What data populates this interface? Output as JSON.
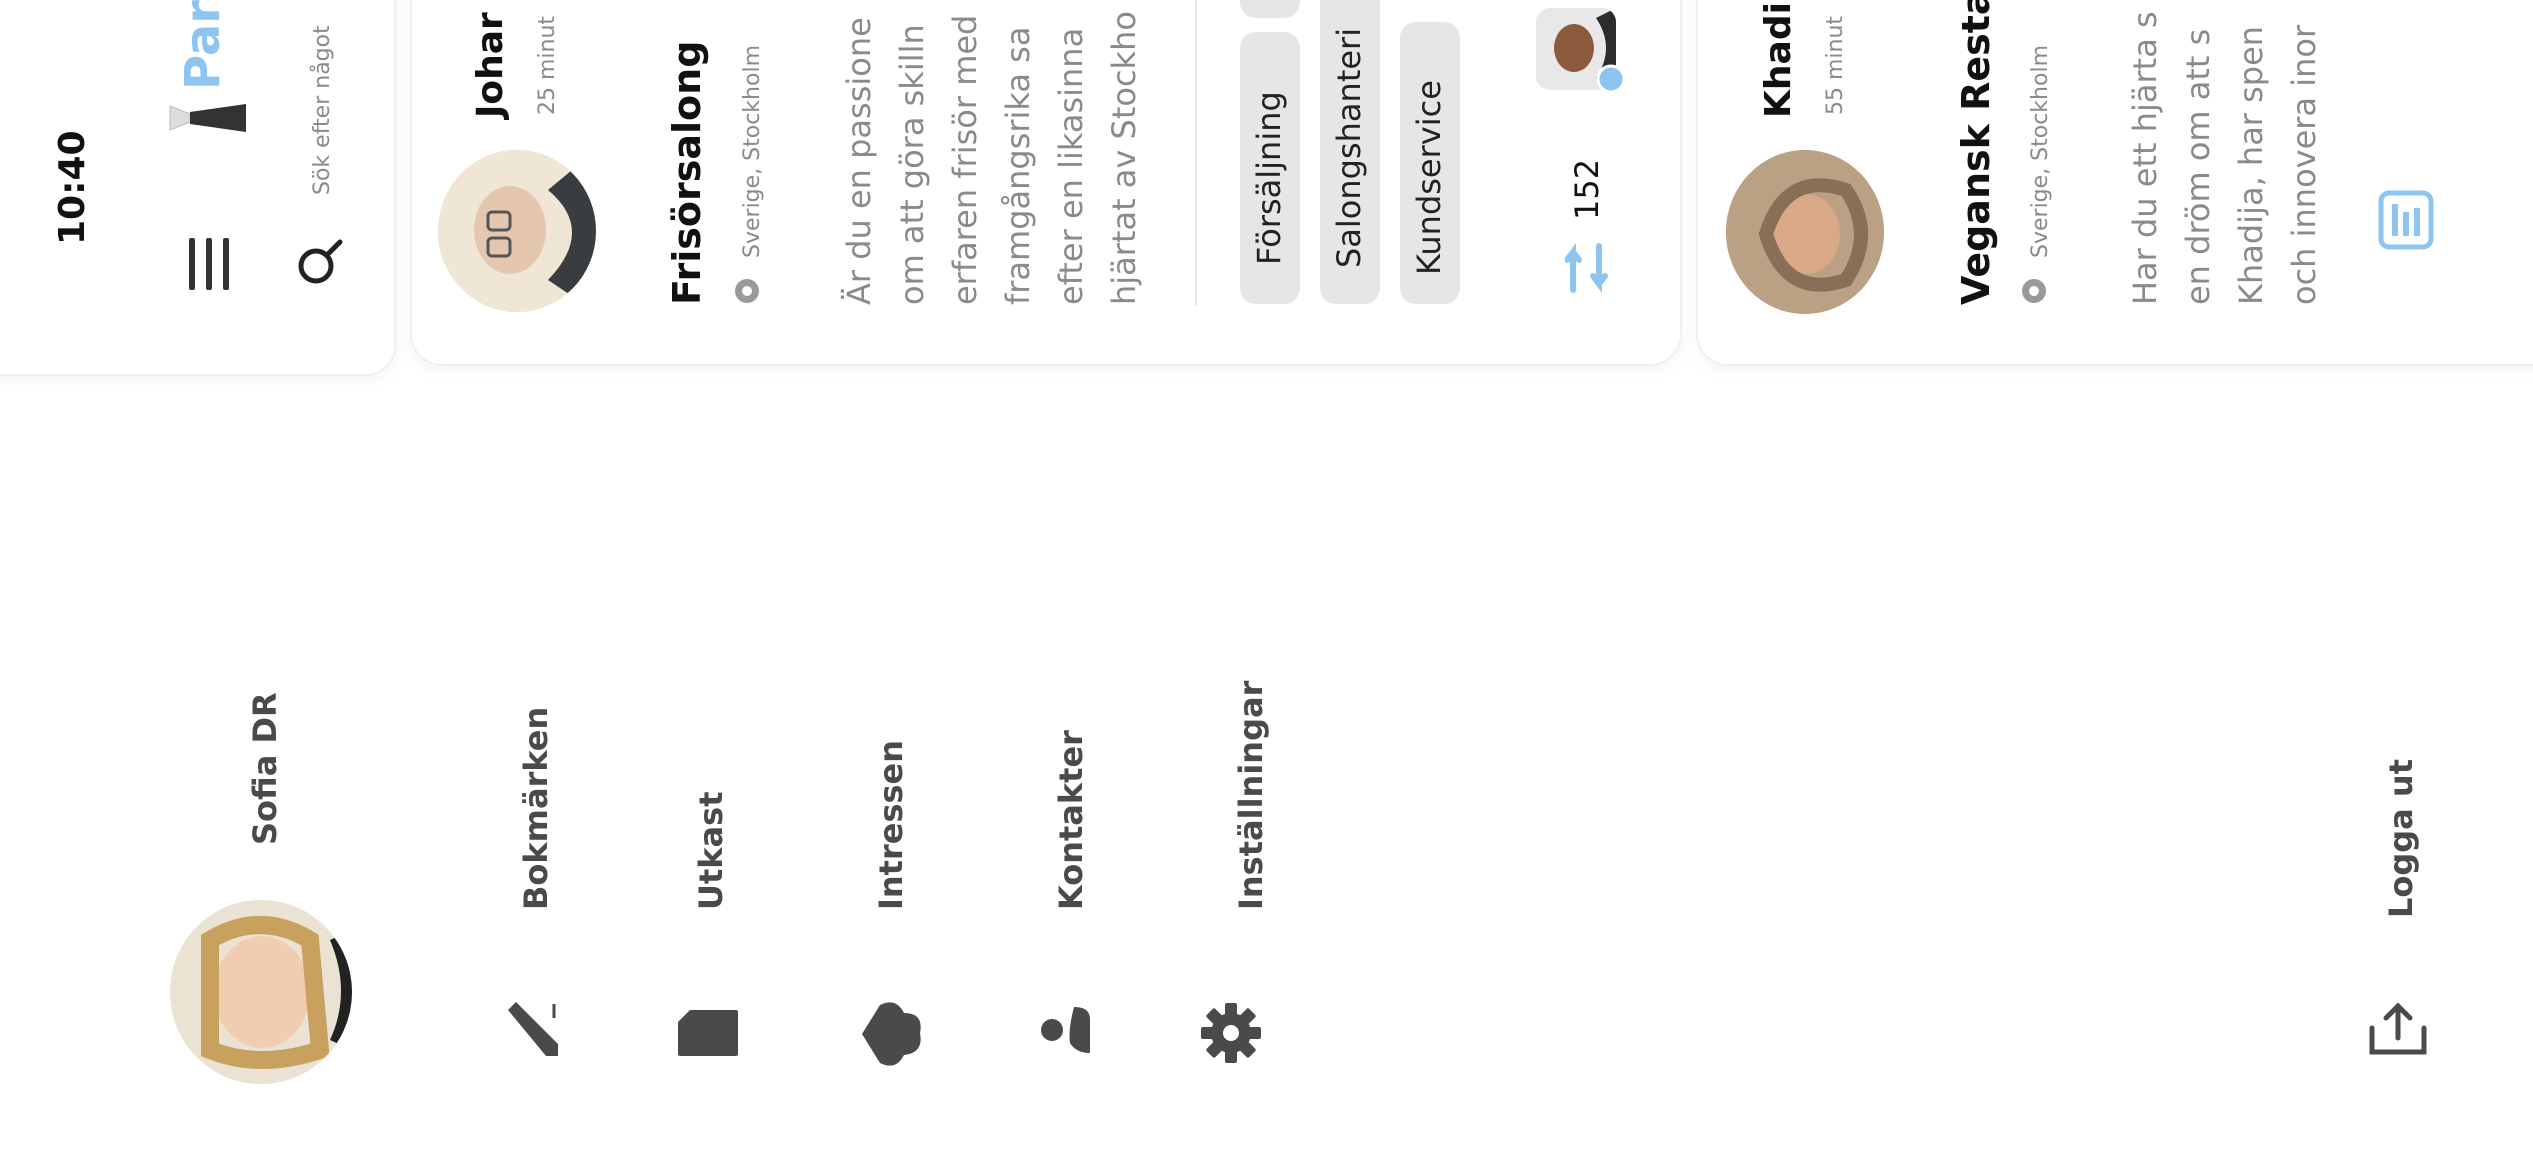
{
  "status_bar": {
    "time": "10:40"
  },
  "app": {
    "name_partial": "Par",
    "search_placeholder": "Sök efter något"
  },
  "profile": {
    "name": "Sofia DR"
  },
  "menu": {
    "items": [
      {
        "label": "Bokmärken",
        "icon": "pencil-icon"
      },
      {
        "label": "Utkast",
        "icon": "draft-icon"
      },
      {
        "label": "Intressen",
        "icon": "heart-icon"
      },
      {
        "label": "Kontakter",
        "icon": "contacts-icon"
      },
      {
        "label": "Inställningar",
        "icon": "gear-icon"
      }
    ],
    "logout_label": "Logga ut"
  },
  "posts": [
    {
      "author": "Johar",
      "time": "25 minut",
      "title": "Frisörsalong",
      "location": "Sverige, Stockholm",
      "body_lines": [
        "Är du en passione",
        "om att göra skilln",
        "erfaren frisör med",
        "framgångsrika sa",
        "efter en likasinna",
        "hjärtat av Stockho"
      ],
      "tags": [
        "Försäljning",
        "Salongshanteri",
        "Kundservice"
      ],
      "count": "152"
    },
    {
      "author": "Khadi",
      "time": "55 minut",
      "title": "Vegansk Restau",
      "location": "Sverige, Stockholm",
      "body_lines": [
        "Har du ett hjärta s",
        "en dröm om att s",
        "Khadija, har spen",
        "och innovera inor"
      ]
    }
  ],
  "colors": {
    "accent": "#8ec5f0",
    "icon_gray": "#4a4a4a",
    "muted": "#8a8a8a"
  }
}
